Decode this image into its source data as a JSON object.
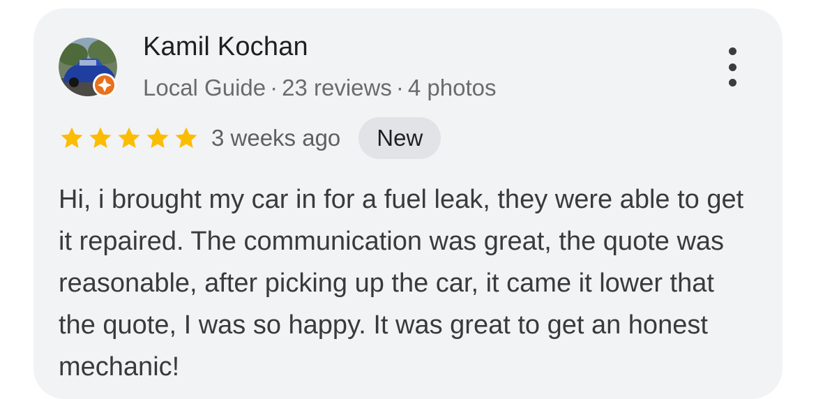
{
  "reviewer": {
    "name": "Kamil Kochan",
    "level": "Local Guide",
    "separator": "·",
    "reviews": "23 reviews",
    "photos": "4 photos"
  },
  "rating": {
    "stars": 5,
    "max": 5,
    "star_color": "#fbbc04"
  },
  "time": "3 weeks ago",
  "badge": "New",
  "review": {
    "text": "Hi, i brought my car in for a fuel leak, they were able to get it repaired. The communication was great, the quote was reasonable, after picking up the car, it came it lower that the quote, I was so happy. It was great to get an honest mechanic!"
  },
  "icons": {
    "more": "more-vert-icon",
    "badge": "local-guide-icon",
    "star": "star-icon"
  },
  "colors": {
    "card_bg": "#f2f3f5",
    "guide_badge": "#e8711c",
    "chip_bg": "#e2e3e6"
  }
}
